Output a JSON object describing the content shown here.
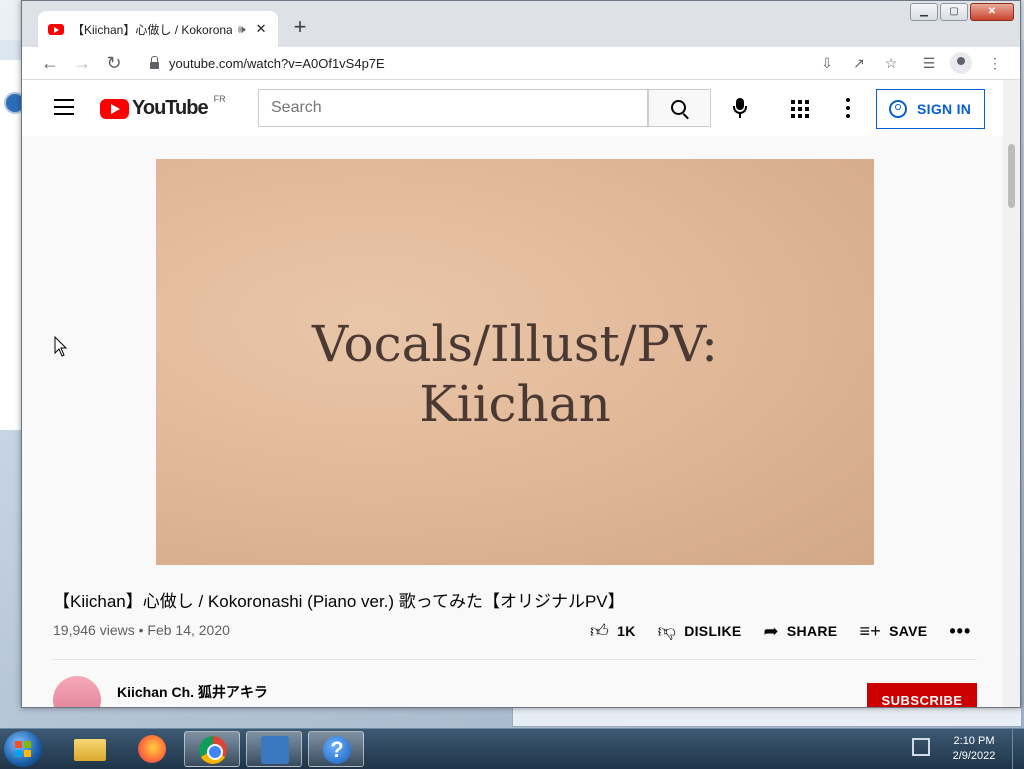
{
  "browser": {
    "tab_title": "【Kiichan】心做し / Kokoronashi",
    "tab_audio_icon": "speaker-icon",
    "tab_close": "✕",
    "new_tab": "+",
    "window_buttons": {
      "minimize": "▁",
      "maximize": "▢",
      "close": "✕"
    },
    "url": "youtube.com/watch?v=A0Of1vS4p7E"
  },
  "youtube": {
    "logo_text": "YouTube",
    "country_code": "FR",
    "search_placeholder": "Search",
    "sign_in_label": "SIGN IN",
    "video_text_line1": "Vocals/Illust/PV:",
    "video_text_line2": "Kiichan",
    "video_title": "【Kiichan】心做し / Kokoronashi (Piano ver.) 歌ってみた【オリジナルPV】",
    "meta": "19,946 views • Feb 14, 2020",
    "actions": {
      "like_count": "1K",
      "dislike_label": "DISLIKE",
      "share_label": "SHARE",
      "save_label": "SAVE",
      "more": "•••"
    },
    "channel_name": "Kiichan Ch. 狐井アキラ",
    "subscribe_label": "SUBSCRIBE"
  },
  "taskbar": {
    "time": "2:10 PM",
    "date": "2/9/2022",
    "help_glyph": "?"
  },
  "colors": {
    "accent_blue": "#065fd4",
    "youtube_red": "#ff0000",
    "subscribe_red": "#cc0000"
  }
}
